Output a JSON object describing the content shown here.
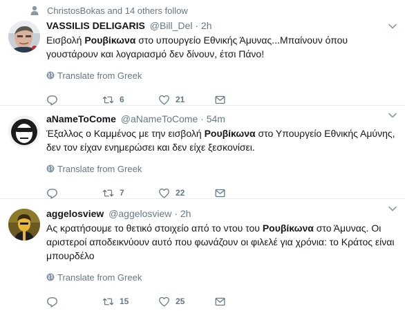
{
  "social_context": {
    "text": "ChristosBokas and 14 others follow"
  },
  "tweets": [
    {
      "fullname": "VASSILIS DELIGARIS",
      "username": "@Bill_Del",
      "dot": "·",
      "time": "2h",
      "text_before": "Εισβολή ",
      "text_bold": "Ρουβίκωνα",
      "text_after": " στο υπουργείο Εθνικής Άμυνας...Μπαίνουν όπου γουστάρουν και λογαριασμό δεν δίνουν, έτσι Πάνο!",
      "translate": "Translate from Greek",
      "reply_count": "",
      "retweet_count": "6",
      "like_count": "21"
    },
    {
      "fullname": "aNameToCome",
      "username": "@aNameToCome",
      "dot": "·",
      "time": "54m",
      "text_before": "Έξαλλος ο Καμμένος με την εισβολή ",
      "text_bold": "Ρουβίκωνα",
      "text_after": " στο Υπουργείο Εθνικής Αμύνης, δεν τον είχαν ενημερώσει και δεν είχε ξεσκονίσει.",
      "translate": "Translate from Greek",
      "reply_count": "",
      "retweet_count": "7",
      "like_count": "22"
    },
    {
      "fullname": "aggelosview",
      "username": "@aggelosview",
      "dot": "·",
      "time": "2h",
      "text_before": "Ας κρατήσουμε το θετικό στοιχείο από το ντου του ",
      "text_bold": "Ρουβίκωνα",
      "text_after": " στο Άμυνας. Οι αριστεροί αποδεικνύουν αυτό που φωνάζουν οι φιλελέ για χρόνια: το Κράτος είναι μπουρδέλο",
      "translate": "Translate from Greek",
      "reply_count": "",
      "retweet_count": "15",
      "like_count": "25"
    }
  ],
  "colors": {
    "secondary_text": "#657786",
    "primary_text": "#14171a",
    "divider": "#e6ecf0"
  },
  "icons": [
    "person-icon",
    "globe-icon",
    "reply-icon",
    "retweet-icon",
    "heart-icon",
    "mail-icon",
    "chevron-down-icon"
  ]
}
